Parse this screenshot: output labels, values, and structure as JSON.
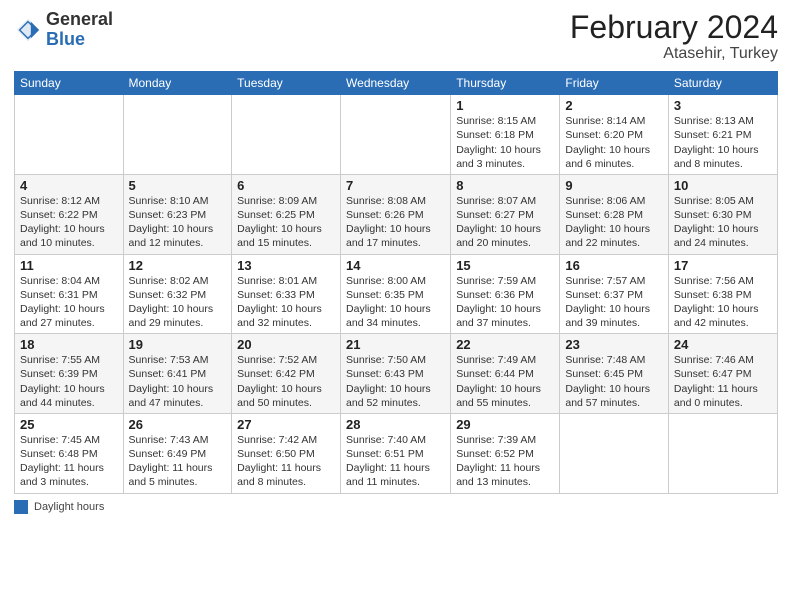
{
  "header": {
    "logo_general": "General",
    "logo_blue": "Blue",
    "main_title": "February 2024",
    "subtitle": "Atasehir, Turkey"
  },
  "days_of_week": [
    "Sunday",
    "Monday",
    "Tuesday",
    "Wednesday",
    "Thursday",
    "Friday",
    "Saturday"
  ],
  "weeks": [
    [
      {
        "day": "",
        "info": ""
      },
      {
        "day": "",
        "info": ""
      },
      {
        "day": "",
        "info": ""
      },
      {
        "day": "",
        "info": ""
      },
      {
        "day": "1",
        "info": "Sunrise: 8:15 AM\nSunset: 6:18 PM\nDaylight: 10 hours\nand 3 minutes."
      },
      {
        "day": "2",
        "info": "Sunrise: 8:14 AM\nSunset: 6:20 PM\nDaylight: 10 hours\nand 6 minutes."
      },
      {
        "day": "3",
        "info": "Sunrise: 8:13 AM\nSunset: 6:21 PM\nDaylight: 10 hours\nand 8 minutes."
      }
    ],
    [
      {
        "day": "4",
        "info": "Sunrise: 8:12 AM\nSunset: 6:22 PM\nDaylight: 10 hours\nand 10 minutes."
      },
      {
        "day": "5",
        "info": "Sunrise: 8:10 AM\nSunset: 6:23 PM\nDaylight: 10 hours\nand 12 minutes."
      },
      {
        "day": "6",
        "info": "Sunrise: 8:09 AM\nSunset: 6:25 PM\nDaylight: 10 hours\nand 15 minutes."
      },
      {
        "day": "7",
        "info": "Sunrise: 8:08 AM\nSunset: 6:26 PM\nDaylight: 10 hours\nand 17 minutes."
      },
      {
        "day": "8",
        "info": "Sunrise: 8:07 AM\nSunset: 6:27 PM\nDaylight: 10 hours\nand 20 minutes."
      },
      {
        "day": "9",
        "info": "Sunrise: 8:06 AM\nSunset: 6:28 PM\nDaylight: 10 hours\nand 22 minutes."
      },
      {
        "day": "10",
        "info": "Sunrise: 8:05 AM\nSunset: 6:30 PM\nDaylight: 10 hours\nand 24 minutes."
      }
    ],
    [
      {
        "day": "11",
        "info": "Sunrise: 8:04 AM\nSunset: 6:31 PM\nDaylight: 10 hours\nand 27 minutes."
      },
      {
        "day": "12",
        "info": "Sunrise: 8:02 AM\nSunset: 6:32 PM\nDaylight: 10 hours\nand 29 minutes."
      },
      {
        "day": "13",
        "info": "Sunrise: 8:01 AM\nSunset: 6:33 PM\nDaylight: 10 hours\nand 32 minutes."
      },
      {
        "day": "14",
        "info": "Sunrise: 8:00 AM\nSunset: 6:35 PM\nDaylight: 10 hours\nand 34 minutes."
      },
      {
        "day": "15",
        "info": "Sunrise: 7:59 AM\nSunset: 6:36 PM\nDaylight: 10 hours\nand 37 minutes."
      },
      {
        "day": "16",
        "info": "Sunrise: 7:57 AM\nSunset: 6:37 PM\nDaylight: 10 hours\nand 39 minutes."
      },
      {
        "day": "17",
        "info": "Sunrise: 7:56 AM\nSunset: 6:38 PM\nDaylight: 10 hours\nand 42 minutes."
      }
    ],
    [
      {
        "day": "18",
        "info": "Sunrise: 7:55 AM\nSunset: 6:39 PM\nDaylight: 10 hours\nand 44 minutes."
      },
      {
        "day": "19",
        "info": "Sunrise: 7:53 AM\nSunset: 6:41 PM\nDaylight: 10 hours\nand 47 minutes."
      },
      {
        "day": "20",
        "info": "Sunrise: 7:52 AM\nSunset: 6:42 PM\nDaylight: 10 hours\nand 50 minutes."
      },
      {
        "day": "21",
        "info": "Sunrise: 7:50 AM\nSunset: 6:43 PM\nDaylight: 10 hours\nand 52 minutes."
      },
      {
        "day": "22",
        "info": "Sunrise: 7:49 AM\nSunset: 6:44 PM\nDaylight: 10 hours\nand 55 minutes."
      },
      {
        "day": "23",
        "info": "Sunrise: 7:48 AM\nSunset: 6:45 PM\nDaylight: 10 hours\nand 57 minutes."
      },
      {
        "day": "24",
        "info": "Sunrise: 7:46 AM\nSunset: 6:47 PM\nDaylight: 11 hours\nand 0 minutes."
      }
    ],
    [
      {
        "day": "25",
        "info": "Sunrise: 7:45 AM\nSunset: 6:48 PM\nDaylight: 11 hours\nand 3 minutes."
      },
      {
        "day": "26",
        "info": "Sunrise: 7:43 AM\nSunset: 6:49 PM\nDaylight: 11 hours\nand 5 minutes."
      },
      {
        "day": "27",
        "info": "Sunrise: 7:42 AM\nSunset: 6:50 PM\nDaylight: 11 hours\nand 8 minutes."
      },
      {
        "day": "28",
        "info": "Sunrise: 7:40 AM\nSunset: 6:51 PM\nDaylight: 11 hours\nand 11 minutes."
      },
      {
        "day": "29",
        "info": "Sunrise: 7:39 AM\nSunset: 6:52 PM\nDaylight: 11 hours\nand 13 minutes."
      },
      {
        "day": "",
        "info": ""
      },
      {
        "day": "",
        "info": ""
      }
    ]
  ],
  "footer": {
    "swatch_label": "Daylight hours"
  }
}
